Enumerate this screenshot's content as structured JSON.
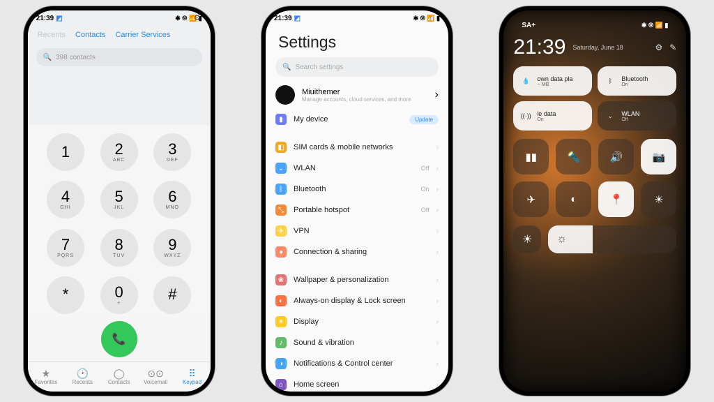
{
  "common": {
    "status_time": "21:39",
    "status_icons": "✱ ⦾ 📶 ▮"
  },
  "dialer": {
    "tabs": {
      "recents": "Recents",
      "contacts": "Contacts",
      "carrier": "Carrier Services"
    },
    "search_text": "398 contacts",
    "keys": [
      {
        "n": "1",
        "l": ""
      },
      {
        "n": "2",
        "l": "ABC"
      },
      {
        "n": "3",
        "l": "DEF"
      },
      {
        "n": "4",
        "l": "GHI"
      },
      {
        "n": "5",
        "l": "JKL"
      },
      {
        "n": "6",
        "l": "MNO"
      },
      {
        "n": "7",
        "l": "PQRS"
      },
      {
        "n": "8",
        "l": "TUV"
      },
      {
        "n": "9",
        "l": "WXYZ"
      },
      {
        "n": "*",
        "l": ""
      },
      {
        "n": "0",
        "l": "+"
      },
      {
        "n": "#",
        "l": ""
      }
    ],
    "nav": [
      {
        "icon": "★",
        "label": "Favorites"
      },
      {
        "icon": "🕑",
        "label": "Recents"
      },
      {
        "icon": "◯",
        "label": "Contacts"
      },
      {
        "icon": "⊙⊙",
        "label": "Voicemail"
      },
      {
        "icon": "⠿",
        "label": "Keypad"
      }
    ]
  },
  "settings": {
    "title": "Settings",
    "search_placeholder": "Search settings",
    "account": {
      "name": "Miuithemer",
      "sub": "Manage accounts, cloud services, and more"
    },
    "mydevice": {
      "label": "My device",
      "badge": "Update"
    },
    "items": [
      {
        "icon": "◧",
        "color": "#f5a623",
        "label": "SIM cards & mobile networks",
        "val": ""
      },
      {
        "icon": "⌄",
        "color": "#4aa3ff",
        "label": "WLAN",
        "val": "Off"
      },
      {
        "icon": "ᛒ",
        "color": "#4aa3ff",
        "label": "Bluetooth",
        "val": "On"
      },
      {
        "icon": "⤡",
        "color": "#f28c3b",
        "label": "Portable hotspot",
        "val": "Off"
      },
      {
        "icon": "✈",
        "color": "#ffd24a",
        "label": "VPN",
        "val": ""
      },
      {
        "icon": "●",
        "color": "#ff8a65",
        "label": "Connection & sharing",
        "val": ""
      }
    ],
    "items2": [
      {
        "icon": "❀",
        "color": "#e57373",
        "label": "Wallpaper & personalization"
      },
      {
        "icon": "◐",
        "color": "#ff7043",
        "label": "Always-on display & Lock screen"
      },
      {
        "icon": "☀",
        "color": "#ffca28",
        "label": "Display"
      },
      {
        "icon": "♪",
        "color": "#66bb6a",
        "label": "Sound & vibration"
      },
      {
        "icon": "◑",
        "color": "#42a5f5",
        "label": "Notifications & Control center"
      },
      {
        "icon": "⌂",
        "color": "#7e57c2",
        "label": "Home screen"
      }
    ]
  },
  "cc": {
    "carrier": "SA+",
    "time": "21:39",
    "date": "Saturday, June 18",
    "tiles": [
      {
        "style": "lt",
        "icon": "💧",
        "title": "own data pla",
        "sub": "-- MB"
      },
      {
        "style": "lt",
        "icon": "ᛒ",
        "title": "Bluetooth",
        "sub": "On"
      },
      {
        "style": "lt",
        "icon": "((·))",
        "title": "le data",
        "sub": "On"
      },
      {
        "style": "dk",
        "icon": "⌄",
        "title": "WLAN",
        "sub": "Off"
      }
    ],
    "quick": [
      {
        "s": "dk",
        "i": "▮▮"
      },
      {
        "s": "dk",
        "i": "🔦"
      },
      {
        "s": "dk",
        "i": "🔊"
      },
      {
        "s": "lt",
        "i": "📷"
      },
      {
        "s": "dk",
        "i": "✈"
      },
      {
        "s": "dk",
        "i": "◐"
      },
      {
        "s": "lt",
        "i": "📍"
      },
      {
        "s": "dk",
        "i": "☀"
      }
    ]
  }
}
